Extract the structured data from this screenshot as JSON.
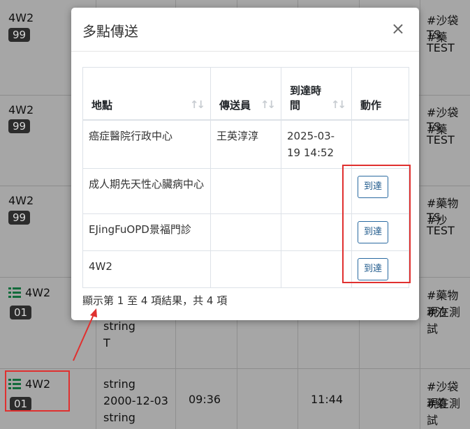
{
  "modal": {
    "title": "多點傳送",
    "close_label": "×",
    "columns": [
      "地點",
      "傳送員",
      "到達時間",
      "動作"
    ],
    "rows": [
      {
        "location": "癌症醫院行政中心",
        "courier": "王英淳淳",
        "arrival_time": "2025-03-19 14:52",
        "action": ""
      },
      {
        "location": "成人期先天性心臟病中心",
        "courier": "",
        "arrival_time": "",
        "action": "到達"
      },
      {
        "location": "EJingFuOPD景福門診",
        "courier": "",
        "arrival_time": "",
        "action": "到達"
      },
      {
        "location": "4W2",
        "courier": "",
        "arrival_time": "",
        "action": "到達"
      }
    ],
    "info": "顯示第 1 至 4 項結果，共 4 項"
  },
  "background": {
    "rows": [
      {
        "ward": "4W2",
        "badge": "99",
        "tags": "#沙袋 #藥",
        "note": "TS TEST"
      },
      {
        "ward": "4W2",
        "badge": "99",
        "tags": "#沙袋 #藥",
        "note": "TS TEST"
      },
      {
        "ward": "4W2",
        "badge": "99",
        "tags": "#藥物 #沙",
        "note": "TS TEST"
      },
      {
        "ward": "4W2",
        "badge": "01",
        "tags": "#藥物 #沙",
        "note": "現在測試",
        "col2_line1": "string",
        "col2_line2": "T"
      },
      {
        "ward": "4W2",
        "badge": "01",
        "tags": "#沙袋 #藥",
        "note": "現在測試",
        "col2_line1": "string",
        "col2_line2": "2000-12-03",
        "col2_line3": "string",
        "time1": "09:36",
        "time2": "11:44"
      }
    ]
  },
  "colors": {
    "annotation": "#e0302f",
    "button_border": "#2a6aa1",
    "list_icon": "#126b3b"
  }
}
